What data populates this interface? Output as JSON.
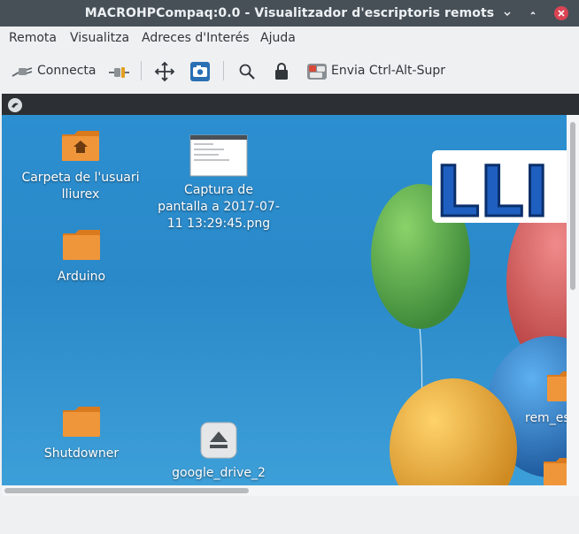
{
  "window": {
    "title": "MACROHPCompaq:0.0 - Visualitzador d'escriptoris remots"
  },
  "menu": {
    "items": [
      "Remota",
      "Visualitza",
      "Adreces d'Interés",
      "Ajuda"
    ]
  },
  "toolbar": {
    "connect_label": "Connecta",
    "send_keys_label": "Envia Ctrl-Alt-Supr"
  },
  "desktop": {
    "icons": [
      {
        "label": "Carpeta de l'usuari\nlliurex",
        "icon": "home-folder-icon"
      },
      {
        "label": "Captura de\npantalla a 2017-07-\n11 13:29:45.png",
        "icon": "screenshot-thumbnail"
      },
      {
        "label": "Arduino",
        "icon": "folder-icon"
      },
      {
        "label": "Shutdowner",
        "icon": "folder-icon"
      },
      {
        "label": "google_drive_2",
        "icon": "eject-icon"
      },
      {
        "label": "rem_es",
        "icon": "folder-icon"
      }
    ],
    "logo_text": "LLI"
  },
  "colors": {
    "titlebar": "#475057",
    "close": "#da4453",
    "desktop_blue": "#2c8fd0"
  }
}
